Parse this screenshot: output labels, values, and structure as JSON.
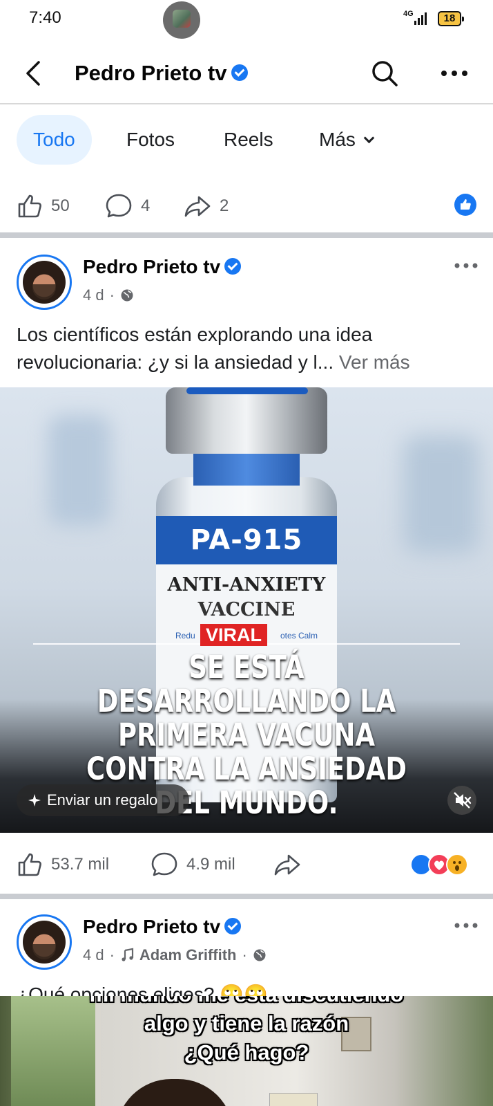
{
  "status": {
    "time": "7:40",
    "network": "4G",
    "battery": "18"
  },
  "header": {
    "title": "Pedro Prieto tv"
  },
  "tabs": [
    {
      "label": "Todo"
    },
    {
      "label": "Fotos"
    },
    {
      "label": "Reels"
    },
    {
      "label": "Más"
    }
  ],
  "prev_post_actions": {
    "likes": "50",
    "comments": "4",
    "shares": "2"
  },
  "post1": {
    "author": "Pedro Prieto tv",
    "age": "4 d",
    "text": "Los científicos están explorando una idea revolucionaria: ¿y si la ansiedad y l...",
    "see_more": "Ver más",
    "media": {
      "vial_code": "PA-915",
      "vial_line1": "ANTI-ANXIETY",
      "vial_line2": "VACCINE",
      "vial_small_left": "Redu",
      "vial_small_right": "otes Calm",
      "badge": "VIRAL",
      "headline_lines": [
        "SE ESTÁ",
        "DESARROLLANDO LA",
        "PRIMERA VACUNA",
        "CONTRA LA ANSIEDAD",
        "DEL MUNDO."
      ],
      "gift_label": "Enviar un regalo"
    },
    "actions": {
      "likes": "53.7 mil",
      "comments": "4.9 mil"
    },
    "reaction_colors": [
      "#1877f2",
      "#f33e58",
      "#f7b125"
    ]
  },
  "post2": {
    "author": "Pedro Prieto tv",
    "age": "4 d",
    "music": "Adam Griffith",
    "text": "¿Qué opciones eliges? 🙄🙄",
    "caption_lines": [
      "mi mundo me está discutiendo",
      "algo y tiene la razón",
      "¿Qué hago?"
    ]
  },
  "colors": {
    "brand": "#1877f2",
    "text": "#1c1e21",
    "muted": "#65676b"
  }
}
